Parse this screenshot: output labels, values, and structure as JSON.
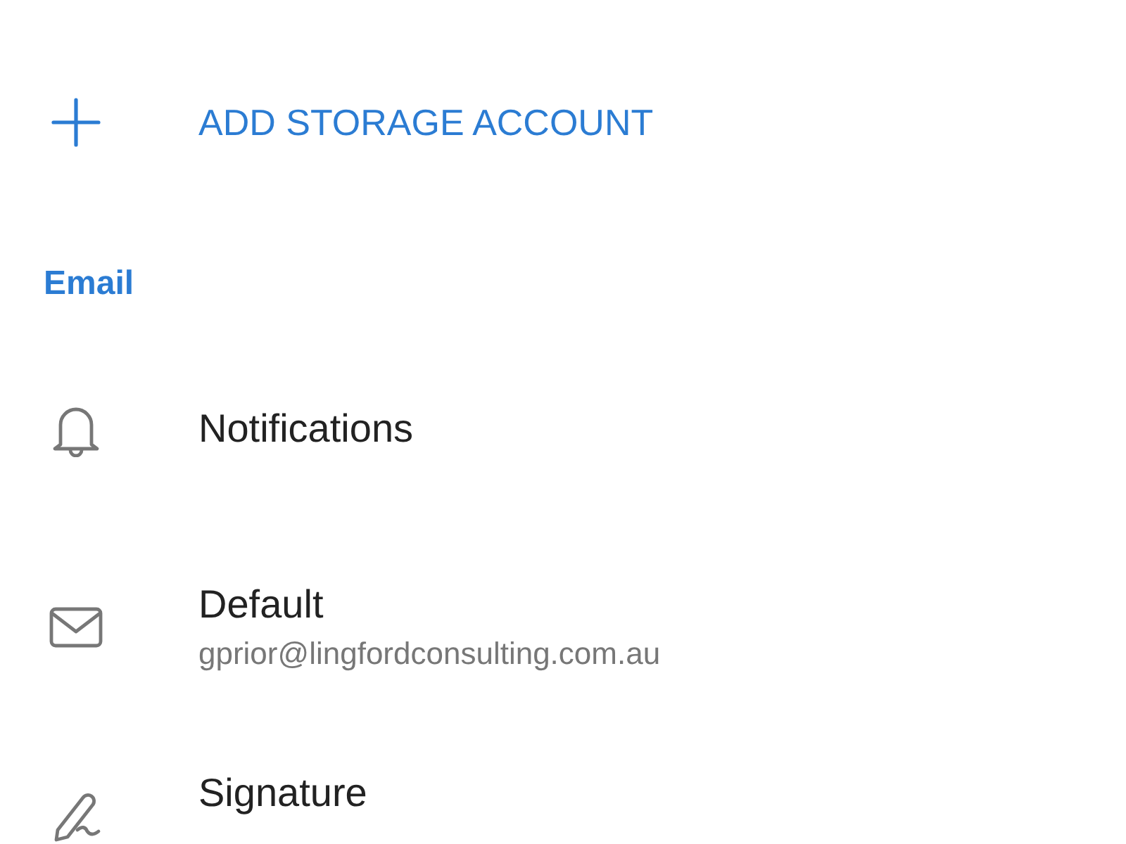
{
  "add_action": {
    "label": "ADD STORAGE ACCOUNT"
  },
  "section": {
    "title": "Email",
    "items": [
      {
        "kind": "bell",
        "title": "Notifications"
      },
      {
        "kind": "envelope",
        "title": "Default",
        "subtitle": "gprior@lingfordconsulting.com.au"
      },
      {
        "kind": "pen",
        "title": "Signature"
      }
    ]
  }
}
